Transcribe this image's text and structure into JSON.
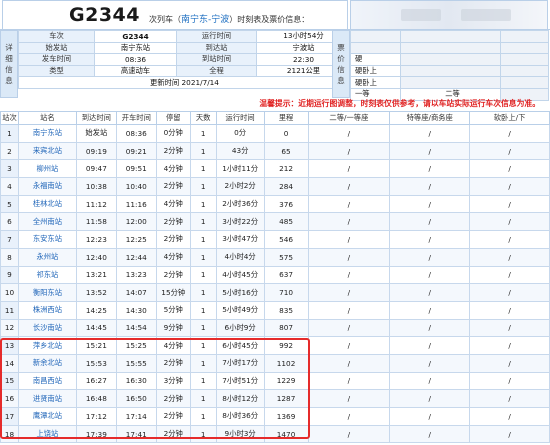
{
  "header": {
    "train_code": "G2344",
    "title_prefix": "次列车（",
    "route": "南宁东-宁波",
    "title_suffix": "）时刻表及票价信息："
  },
  "details": {
    "side_label": [
      "详",
      "细",
      "信",
      "息"
    ],
    "rows": [
      {
        "l1": "车次",
        "v1": "G2344",
        "l2": "运行时间",
        "v2": "13小时54分"
      },
      {
        "l1": "始发站",
        "v1": "南宁东站",
        "l2": "到达站",
        "v2": "宁波站"
      },
      {
        "l1": "发车时间",
        "v1": "08:36",
        "l2": "到站时间",
        "v2": "22:30"
      },
      {
        "l1": "类型",
        "v1": "高速动车",
        "l2": "全程",
        "v2": "2121公里"
      }
    ],
    "updated": "更新时间 2021/7/14"
  },
  "price": {
    "side_label": [
      "票",
      "价",
      "信",
      "息"
    ],
    "seats": [
      "",
      "",
      "硬",
      "硬卧上",
      "硬卧上",
      "一等"
    ],
    "right_header": "二等"
  },
  "notice": "温馨提示：近期运行图调整，时刻表仅供参考，请以车站实际运行车次信息为准。",
  "table": {
    "columns": [
      "站次",
      "站名",
      "到达时间",
      "开车时间",
      "停留",
      "天数",
      "运行时间",
      "里程",
      "二等/一等座",
      "特等座/商务座",
      "软卧上/下"
    ],
    "rows": [
      [
        "1",
        "南宁东站",
        "始发站",
        "08:36",
        "0分钟",
        "1",
        "0分",
        "0",
        "/",
        "/",
        "/"
      ],
      [
        "2",
        "来宾北站",
        "09:19",
        "09:21",
        "2分钟",
        "1",
        "43分",
        "65",
        "/",
        "/",
        "/"
      ],
      [
        "3",
        "柳州站",
        "09:47",
        "09:51",
        "4分钟",
        "1",
        "1小时11分",
        "212",
        "/",
        "/",
        "/"
      ],
      [
        "4",
        "永福南站",
        "10:38",
        "10:40",
        "2分钟",
        "1",
        "2小时2分",
        "284",
        "/",
        "/",
        "/"
      ],
      [
        "5",
        "桂林北站",
        "11:12",
        "11:16",
        "4分钟",
        "1",
        "2小时36分",
        "376",
        "/",
        "/",
        "/"
      ],
      [
        "6",
        "全州南站",
        "11:58",
        "12:00",
        "2分钟",
        "1",
        "3小时22分",
        "485",
        "/",
        "/",
        "/"
      ],
      [
        "7",
        "东安东站",
        "12:23",
        "12:25",
        "2分钟",
        "1",
        "3小时47分",
        "546",
        "/",
        "/",
        "/"
      ],
      [
        "8",
        "永州站",
        "12:40",
        "12:44",
        "4分钟",
        "1",
        "4小时4分",
        "575",
        "/",
        "/",
        "/"
      ],
      [
        "9",
        "祁东站",
        "13:21",
        "13:23",
        "2分钟",
        "1",
        "4小时45分",
        "637",
        "/",
        "/",
        "/"
      ],
      [
        "10",
        "衡阳东站",
        "13:52",
        "14:07",
        "15分钟",
        "1",
        "5小时16分",
        "710",
        "/",
        "/",
        "/"
      ],
      [
        "11",
        "株洲西站",
        "14:25",
        "14:30",
        "5分钟",
        "1",
        "5小时49分",
        "835",
        "/",
        "/",
        "/"
      ],
      [
        "12",
        "长沙南站",
        "14:45",
        "14:54",
        "9分钟",
        "1",
        "6小时9分",
        "807",
        "/",
        "/",
        "/"
      ],
      [
        "13",
        "萍乡北站",
        "15:21",
        "15:25",
        "4分钟",
        "1",
        "6小时45分",
        "992",
        "/",
        "/",
        "/"
      ],
      [
        "14",
        "新余北站",
        "15:53",
        "15:55",
        "2分钟",
        "1",
        "7小时17分",
        "1102",
        "/",
        "/",
        "/"
      ],
      [
        "15",
        "南昌西站",
        "16:27",
        "16:30",
        "3分钟",
        "1",
        "7小时51分",
        "1229",
        "/",
        "/",
        "/"
      ],
      [
        "16",
        "进贤南站",
        "16:48",
        "16:50",
        "2分钟",
        "1",
        "8小时12分",
        "1287",
        "/",
        "/",
        "/"
      ],
      [
        "17",
        "鹰潭北站",
        "17:12",
        "17:14",
        "2分钟",
        "1",
        "8小时36分",
        "1369",
        "/",
        "/",
        "/"
      ],
      [
        "18",
        "上饶站",
        "17:39",
        "17:41",
        "2分钟",
        "1",
        "9小时3分",
        "1470",
        "/",
        "/",
        "/"
      ]
    ]
  },
  "colors": {
    "accent": "#1e64b8",
    "notice": "#e02222",
    "highlight": "#e52b2b"
  }
}
